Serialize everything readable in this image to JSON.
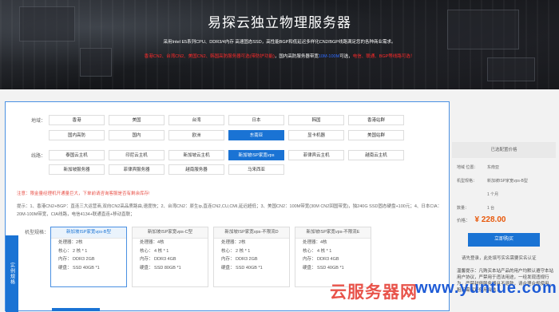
{
  "banner": {
    "title": "易探云独立物理服务器",
    "subtitle": "采用Intel E5系列CPU、DDR3/4内存 高速固态SSD，高性能BGP和低延迟多样化CN2/BGP线路满足您的各种商业需求。",
    "line2": {
      "part1": "香港CN2、台湾CN2、美国CN2、韩国高防服务器可选",
      "part2": "(带防护功能)",
      "part3": "，国内高防服务器带宽",
      "part4": "10M-100M",
      "part5": "可选，",
      "part6": "电信、联通、BGP等线路可选！"
    }
  },
  "region": {
    "label": "地域：",
    "options": [
      "香港",
      "美国",
      "台湾",
      "日本",
      "韩国",
      "香港站群",
      "国内高防",
      "国内",
      "欧洲",
      "东南亚",
      "显卡机器",
      "美国站群"
    ],
    "selected": "东南亚"
  },
  "line": {
    "label": "线路：",
    "options": [
      "泰国云主机",
      "印尼云主机",
      "新加坡云主机",
      "新加坡ISP家宽vps",
      "菲律宾云主机",
      "越南云主机",
      "新加坡服务器",
      "菲律宾服务器",
      "越南服务器",
      "马来西亚"
    ],
    "selected": "新加坡ISP家宽vps"
  },
  "notice": {
    "label": "注意：",
    "text": "限金量经理机开通量巨大，下单前请咨询客服是否有剩余库存!"
  },
  "tips": {
    "label": "提示：",
    "text": "1、香港CN2+BGP：直连三大运营商,双向CN2高品质路由,速度快；2、台湾CN2：原生ip,直连CN2,CU,CMI,延迟超低；3、美国CN2：100M带宽(30M CN2回国带宽)，独240G SSD固态硬盘+100元；4、日本CIA：20M-100M带宽，CIA线路，电信4134+联通直连+移动直联；"
  },
  "side_tab": "实例规格",
  "spec_label": "机型规格：",
  "cards": [
    {
      "title": "新加坡ISP家宽vps-B型",
      "cpu": "处理器：2核",
      "cores": "核心：   2 核 * 1",
      "ram": "内存：   DDR3 2GB",
      "disk": "硬盘：   SSD 40GB *1"
    },
    {
      "title": "新加坡ISP家宽vps-C型",
      "cpu": "处理器：4核",
      "cores": "核心：   4 核 * 1",
      "ram": "内存：   DDR3 4GB",
      "disk": "硬盘：   SSD 80GB *1"
    },
    {
      "title": "新加坡ISP家宽vps-不限流D",
      "cpu": "处理器：2核",
      "cores": "核心：   2 核 * 1",
      "ram": "内存：   DDR3 2GB",
      "disk": "硬盘：   SSD 40GB *1"
    },
    {
      "title": "新加坡ISP家宽vps-不限流E",
      "cpu": "处理器：4核",
      "cores": "核心：   4 核 * 1",
      "ram": "内存：   DDR3 4GB",
      "disk": "硬盘：   SSD 40GB *1"
    }
  ],
  "config": {
    "header": "已选配置价格",
    "rows": [
      {
        "k": "地域 位置：",
        "v": "东南亚"
      },
      {
        "k": "机型规格：",
        "v": "新加坡ISP家宽vps-B型"
      },
      {
        "k": "数量：",
        "v": "1 台"
      }
    ],
    "duration": "1 个月",
    "price_label": "价格：",
    "price": "¥ 228.00",
    "buy_label": "立即购买",
    "login_tip": "请先登录，此处填写实名需要实名认证",
    "warm": "温馨提示：凡购买本站产品的用户均默认遵守本站用户协议，严禁用于违法用途，一经发现违规行为，严禁封停服务器且不退款，请合理合规使用，租用需保证使用合法..."
  },
  "watermark": {
    "cn": "云服务器网",
    "en": "www.yuntue.com"
  }
}
